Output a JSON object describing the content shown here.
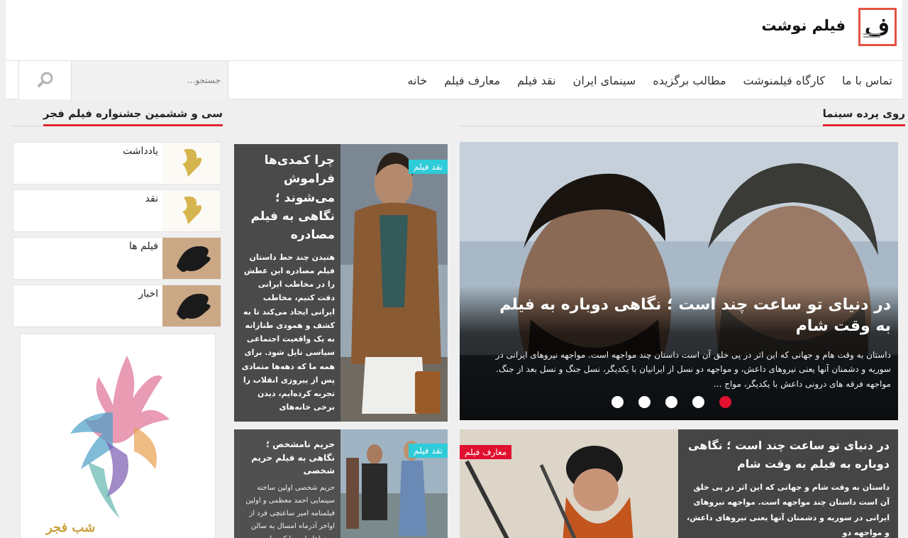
{
  "header": {
    "site_title": "فیلم نوشت",
    "logo_glyph": "ف"
  },
  "nav": {
    "items": [
      "خانه",
      "معارف فیلم",
      "نقد فیلم",
      "سینمای ایران",
      "مطالب برگزیده",
      "کارگاه فیلمنوشت",
      "تماس با ما"
    ],
    "search_placeholder": "جستجو..."
  },
  "sections": {
    "main_title": "روی پرده سینما",
    "side_title": "سی و ششمین جشنواره فیلم فجر"
  },
  "slider": {
    "title": "در دنیای تو ساعت چند است ؛ نگاهی دوباره به فیلم به وقت شام",
    "excerpt": "داستان به وقت هام و جهانی که این اثر در پی خلق آن است داستان چند مواجهه است. مواجهه نیروهای ایرانی در سوریه و دشمنان آنها یعنی نیروهای داعش، و مواجهه دو نسل از ایرانیان با یکدیگر، نسل جنگ و نسل بعد از جنگ. مواجهه فرقه های درونی داعش با یکدیگر، مواج ...",
    "dots_count": 5,
    "active_dot": 5
  },
  "card_main": {
    "badge": "نقد فیلم",
    "title": "چرا کمدی‌ها فراموش می‌شوند ؛ نگاهی به فیلم مصادره",
    "excerpt": "هنیدن چند خط داستان فیلم مصادره این عطش را در مخاطب ایرانی دقت کنیم، مخاطب ایرانی ایجاد می‌کند تا به کشف و همودی طنازانه به یک واقعیت اجتماعی سیاسی نایل شود. برای همه ما که دهه‌ها متمادی پس از پیروزی انقلاب را تجربه کرده‌ایم، دیدن برخی خانه‌های"
  },
  "card_bottom_left": {
    "badge": "نقد فیلم",
    "title": "حریم نامشخص ؛ نگاهی به فیلم حریم شخصی",
    "excerpt": "حریم شخصی اولین ساخته سینمایی احمد معظمی و اولین فیلمنامه امیر ساعتچی فرد از اواخر آذرماه امسال به سالن سینماها راه پیدا کرد. این در"
  },
  "card_bottom_right": {
    "badge": "معارف فیلم",
    "title": "در دنیای تو ساعت چند است ؛ نگاهی دوباره به فیلم به وقت شام",
    "excerpt": "داستان به وقت شام و جهانی که این اثر در پی خلق آن است داستان چند مواجهه است. مواجهه نیروهای ایرانی در سوریه و دشمنان آنها یعنی نیروهای داعش، و مواجهه دو"
  },
  "sidebar": {
    "items": [
      "یادداشت",
      "نقد",
      "فیلم ها",
      "اخبار"
    ],
    "poster_text": "شب فجر"
  },
  "colors": {
    "accent": "#e0262e",
    "badge_cyan": "#2ecbd9",
    "badge_red": "#e0102e"
  }
}
